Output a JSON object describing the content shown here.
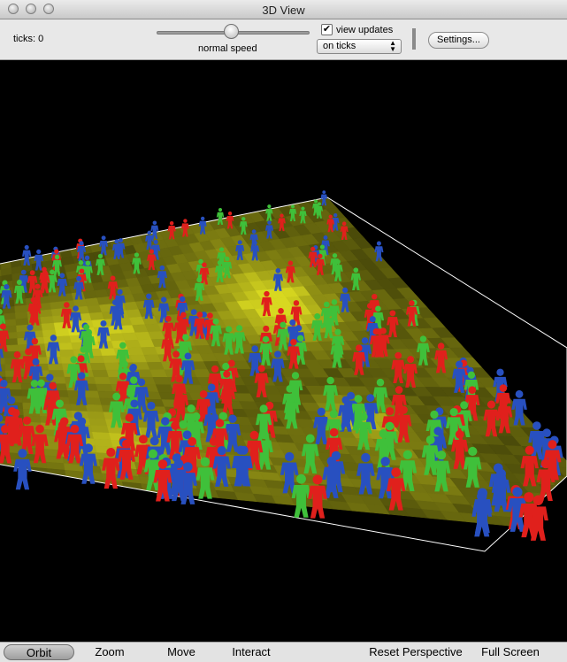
{
  "window": {
    "title": "3D View"
  },
  "toolbar": {
    "ticks_label": "ticks: 0",
    "speed_label": "normal speed",
    "view_updates_label": "view updates",
    "view_updates_checked": true,
    "update_mode_value": "on ticks",
    "settings_label": "Settings..."
  },
  "bottom": {
    "orbit": "Orbit",
    "zoom": "Zoom",
    "move": "Move",
    "interact": "Interact",
    "reset": "Reset Perspective",
    "fullscreen": "Full Screen",
    "active_mode": "Orbit"
  },
  "colors": {
    "patch_bright": "#d8d820",
    "patch_dark": "#101000",
    "turtle_red": "#e0201c",
    "turtle_green": "#3fc03a",
    "turtle_blue": "#2850c0"
  }
}
